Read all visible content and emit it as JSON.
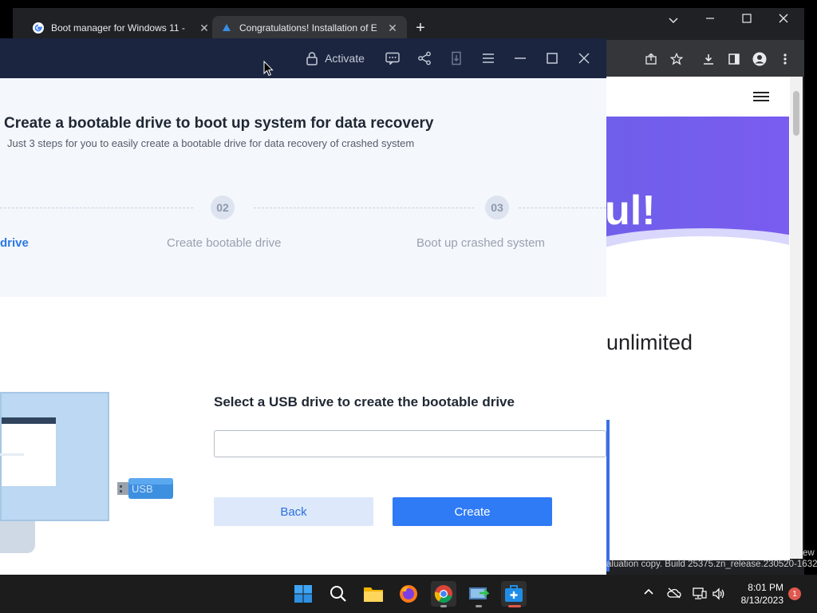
{
  "browser": {
    "tabs": [
      {
        "title": "Boot manager for Windows 11 -",
        "close": "✕"
      },
      {
        "title": "Congratulations! Installation of E",
        "close": "✕"
      }
    ],
    "new_tab": "+",
    "window_controls": {
      "dropdown": "⌄",
      "minimize": "—",
      "maximize": "☐",
      "close": "✕"
    },
    "page": {
      "hero_text": "ul!",
      "body_text": "unlimited"
    },
    "watermark": "aluation copy. Build 25375.zn_release.230520-1632",
    "watermark_edge": "ew"
  },
  "app": {
    "titlebar": {
      "activate_label": "Activate"
    },
    "heading": "Create a bootable drive to boot up system for data recovery",
    "subheading": "Just 3 steps for you to easily create a bootable drive for data recovery of crashed system",
    "steps": [
      {
        "number": "",
        "label": "drive"
      },
      {
        "number": "02",
        "label": "Create bootable drive"
      },
      {
        "number": "03",
        "label": "Boot up crashed system"
      }
    ],
    "usb_text": "USB",
    "select_label": "Select a USB drive to create the bootable drive",
    "drive_value": "",
    "back_label": "Back",
    "create_label": "Create"
  },
  "taskbar": {
    "apps": [
      "start-icon",
      "search-icon",
      "file-explorer-icon",
      "firefox-icon",
      "chrome-icon",
      "network-app-icon",
      "recovery-app-icon"
    ],
    "tray": {
      "chevron": "^"
    },
    "clock_time": "8:01 PM",
    "clock_date": "8/13/2023",
    "notification_count": "1"
  },
  "colors": {
    "accent": "#2f7af5",
    "app_titlebar": "#1b2540",
    "step_active": "#2b78e4",
    "hero": "#6f5fea"
  }
}
